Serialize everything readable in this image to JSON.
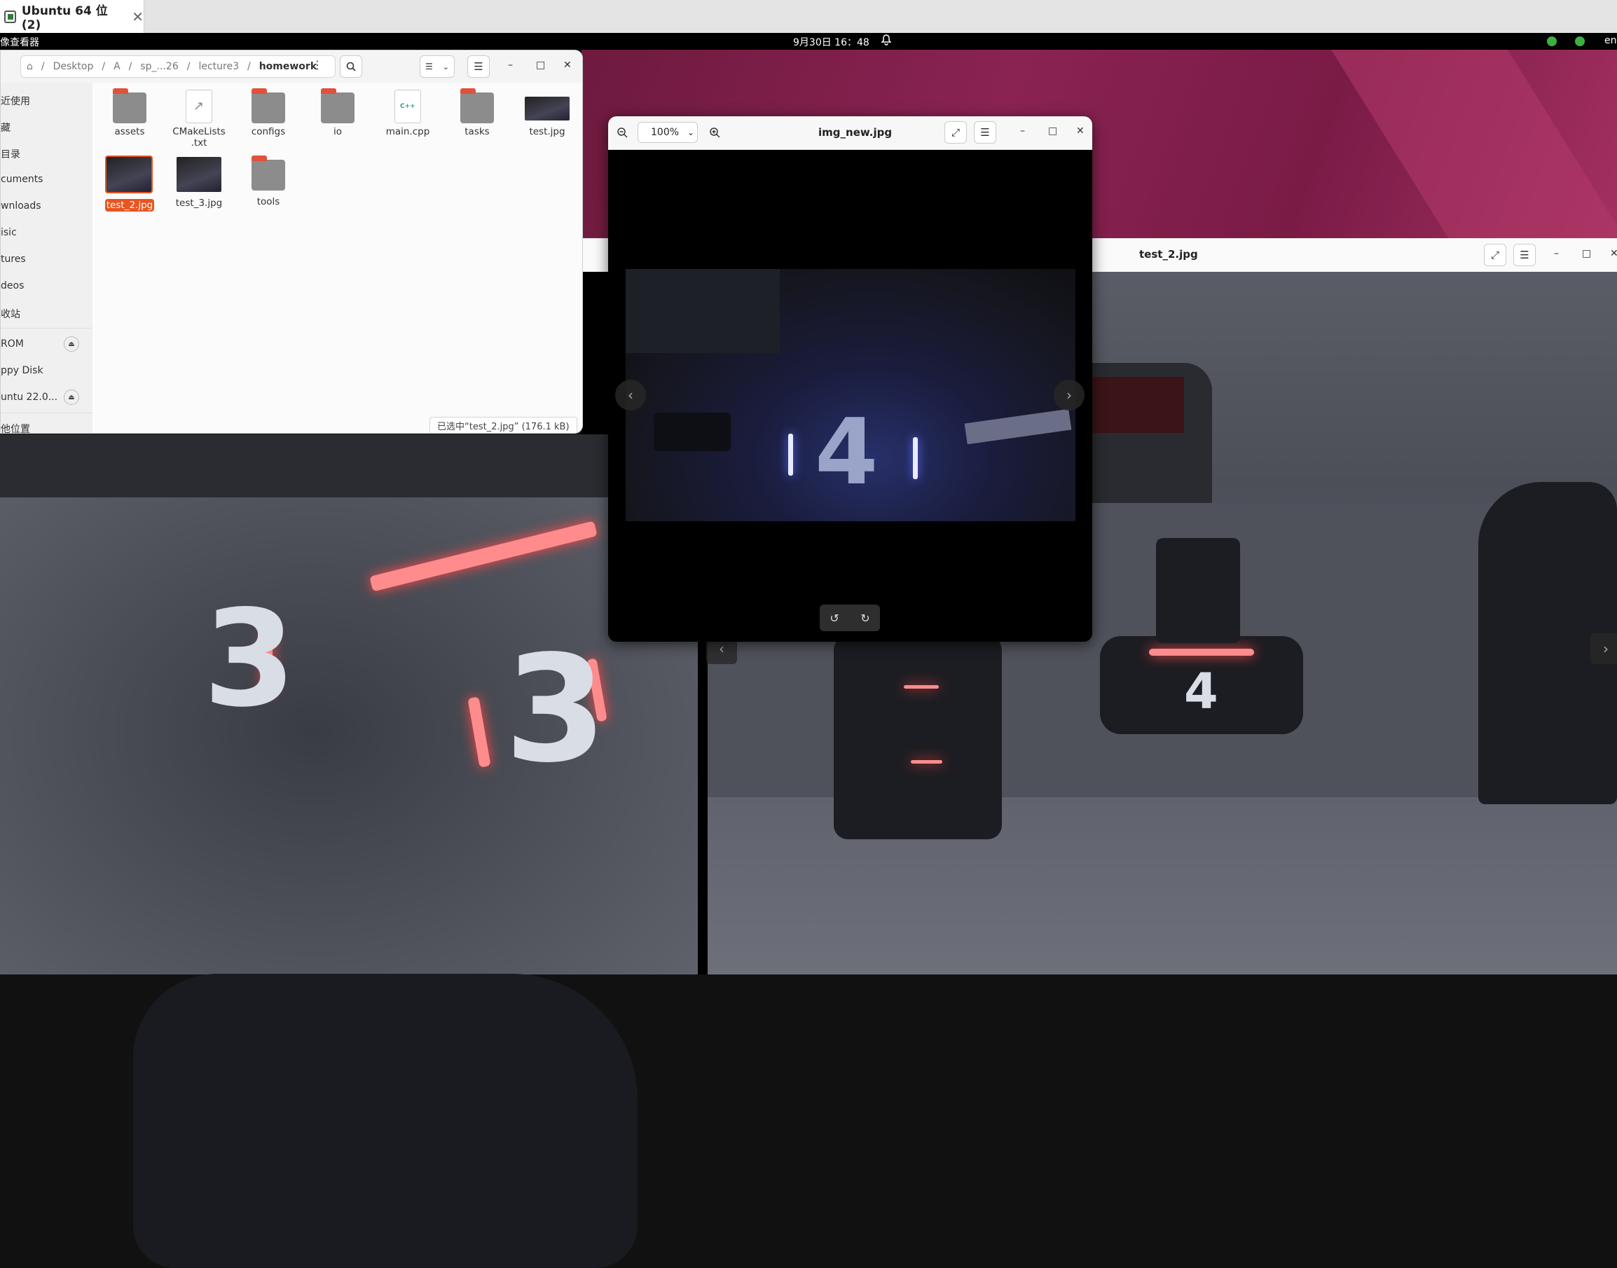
{
  "host_tab": {
    "title": "Ubuntu 64 位 (2)",
    "close": "✕"
  },
  "topbar": {
    "app_name": "像查看器",
    "clock": "9月30日 16：48",
    "lang": "en"
  },
  "file_manager": {
    "breadcrumb": [
      "Desktop",
      "A",
      "sp_...26",
      "lecture3",
      "homework"
    ],
    "sidebar": [
      {
        "label": "近使用"
      },
      {
        "label": "藏"
      },
      {
        "label": "目录"
      },
      {
        "label": "cuments"
      },
      {
        "label": "wnloads"
      },
      {
        "label": "isic"
      },
      {
        "label": "tures"
      },
      {
        "label": "deos"
      },
      {
        "label": "收站"
      },
      {
        "label": "ROM"
      },
      {
        "label": "ppy Disk"
      },
      {
        "label": "untu 22.0..."
      },
      {
        "label": "他位置"
      }
    ],
    "files": [
      {
        "name": "assets"
      },
      {
        "name": "CMakeLists\n.txt"
      },
      {
        "name": "configs"
      },
      {
        "name": "io"
      },
      {
        "name": "main.cpp"
      },
      {
        "name": "tasks"
      },
      {
        "name": "test.jpg"
      },
      {
        "name": "test_2.jpg"
      },
      {
        "name": "test_3.jpg"
      },
      {
        "name": "tools"
      }
    ],
    "cpp_badge": "C++",
    "status": "已选中“test_2.jpg” (176.1 kB)"
  },
  "viewer_front": {
    "title": "img_new.jpg",
    "zoom": "100%",
    "photo_number": "4"
  },
  "viewer_back": {
    "title": "test_2.jpg"
  },
  "photo_numbers": {
    "left_a": "3",
    "left_b": "3",
    "right": "4"
  },
  "colors": {
    "accent": "#e95420",
    "wallpaper": "#7a1b46"
  }
}
